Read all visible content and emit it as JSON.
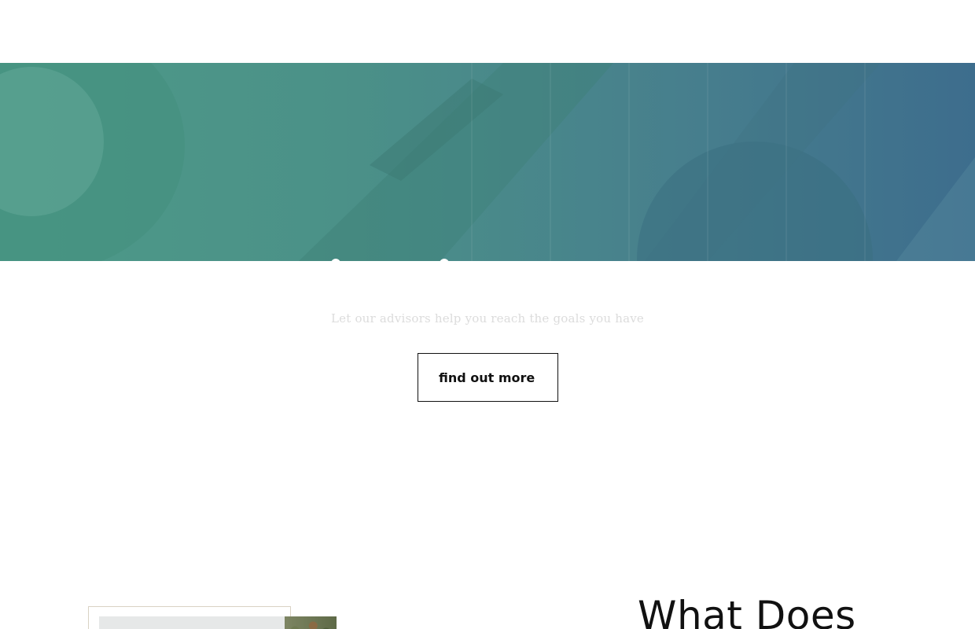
{
  "hero": {
    "image_description": "",
    "gradient_start": "#4d9a88",
    "gradient_end": "#3d6d8d"
  },
  "main": {
    "tagline": "Let our advisors help you reach the goals you have",
    "cta_label": "find out more"
  },
  "feature": {
    "heading": "What Does"
  },
  "colors": {
    "text": "#111111",
    "tagline": "#dcdcdc",
    "frame_border": "#d9d2c4"
  }
}
